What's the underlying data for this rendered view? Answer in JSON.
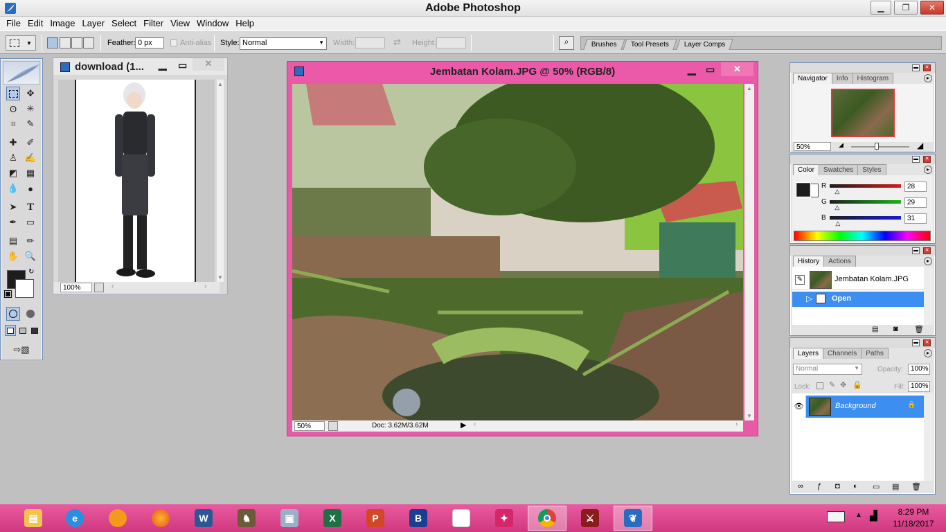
{
  "app": {
    "title": "Adobe Photoshop"
  },
  "menu": [
    "File",
    "Edit",
    "Image",
    "Layer",
    "Select",
    "Filter",
    "View",
    "Window",
    "Help"
  ],
  "options": {
    "feather_label": "Feather:",
    "feather_value": "0 px",
    "antialias_label": "Anti-alias",
    "style_label": "Style:",
    "style_value": "Normal",
    "width_label": "Width:",
    "height_label": "Height:",
    "palette_well_tabs": [
      "Brushes",
      "Tool Presets",
      "Layer Comps"
    ]
  },
  "doc_small": {
    "title": "download (1...",
    "zoom": "100%"
  },
  "doc_main": {
    "title": "Jembatan Kolam.JPG @ 50% (RGB/8)",
    "zoom": "50%",
    "doc_info": "Doc: 3.62M/3.62M"
  },
  "navigator": {
    "tabs": [
      "Navigator",
      "Info",
      "Histogram"
    ],
    "zoom": "50%"
  },
  "color": {
    "tabs": [
      "Color",
      "Swatches",
      "Styles"
    ],
    "channels": [
      {
        "label": "R",
        "value": "28",
        "fraction": 0.11
      },
      {
        "label": "G",
        "value": "29",
        "fraction": 0.11
      },
      {
        "label": "B",
        "value": "31",
        "fraction": 0.12
      }
    ],
    "colors": {
      "red": "#d41c1c",
      "green": "#1ab21a",
      "blue": "#1a1ad0",
      "foreground": "#1c1d1f"
    }
  },
  "history": {
    "tabs": [
      "History",
      "Actions"
    ],
    "snapshot": "Jembatan Kolam.JPG",
    "states": [
      "Open"
    ]
  },
  "layers": {
    "tabs": [
      "Layers",
      "Channels",
      "Paths"
    ],
    "blend_mode": "Normal",
    "opacity_label": "Opacity:",
    "opacity": "100%",
    "lock_label": "Lock:",
    "fill_label": "Fill:",
    "fill": "100%",
    "items": [
      "Background"
    ]
  },
  "taskbar": {
    "time": "8:29 PM",
    "date": "11/18/2017",
    "apps": [
      "file-explorer",
      "internet-explorer",
      "app-orange",
      "firefox",
      "word",
      "app-horse",
      "app-monitor",
      "excel",
      "powerpoint",
      "app-blue",
      "blank-document",
      "android",
      "chrome",
      "dota",
      "photoshop"
    ]
  }
}
